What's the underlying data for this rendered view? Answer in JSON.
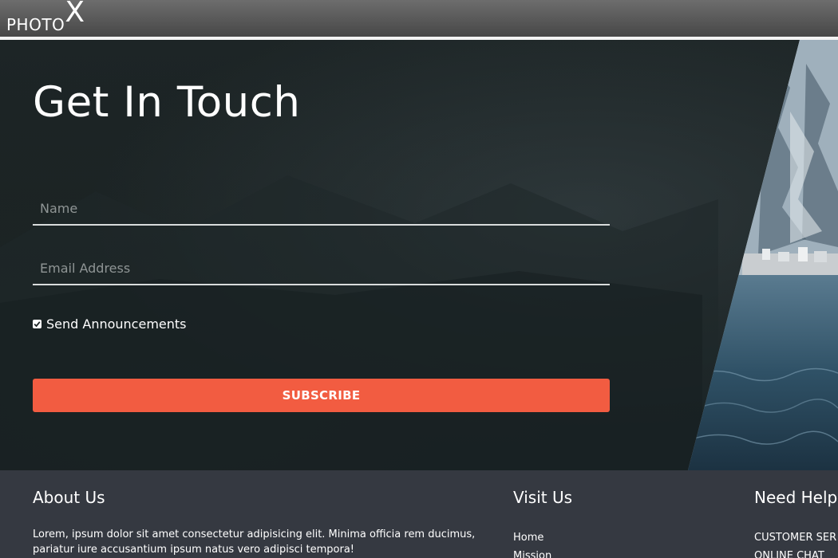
{
  "navbar": {
    "logo_main": "PHOTO",
    "logo_x": "X"
  },
  "hero": {
    "title": "Get In Touch",
    "name_placeholder": "Name",
    "email_placeholder": "Email Address",
    "checkbox_label": "Send Announcements",
    "checkbox_checked": true,
    "subscribe_label": "SUBSCRIBE"
  },
  "footer": {
    "about": {
      "heading": "About Us",
      "text": "Lorem, ipsum dolor sit amet consectetur adipisicing elit. Minima officia rem ducimus, pariatur iure accusantium ipsum natus vero adipisci tempora!"
    },
    "visit": {
      "heading": "Visit Us",
      "links": [
        "Home",
        "Mission"
      ]
    },
    "help": {
      "heading": "Need Help",
      "links": [
        "CUSTOMER SER",
        "ONLINE CHAT"
      ]
    }
  },
  "colors": {
    "accent": "#f25c41",
    "navbar": "#555555",
    "footer": "#353941",
    "hero_bg": "#1d2526"
  }
}
